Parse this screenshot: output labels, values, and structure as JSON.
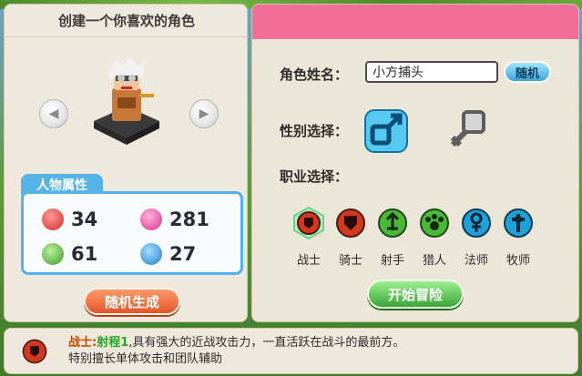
{
  "left_panel": {
    "title": "创建一个你喜欢的角色",
    "attributes_title": "人物属性",
    "attributes": [
      {
        "value": "34",
        "icon": "attack-icon",
        "color": "#e24a4a"
      },
      {
        "value": "281",
        "icon": "heart-icon",
        "color": "#e64aa5"
      },
      {
        "value": "61",
        "icon": "agility-icon",
        "color": "#58c23b"
      },
      {
        "value": "27",
        "icon": "defense-icon",
        "color": "#3aa0e8"
      }
    ],
    "random_generate_label": "随机生成"
  },
  "right_panel": {
    "name_label": "角色姓名：",
    "name_value": "小方捕头",
    "random_label": "随机",
    "gender_label": "性别选择：",
    "job_label": "职业选择：",
    "jobs": [
      {
        "label": "战士",
        "icon": "warrior-icon",
        "color": "#d2371f"
      },
      {
        "label": "骑士",
        "icon": "knight-icon",
        "color": "#d2371f"
      },
      {
        "label": "射手",
        "icon": "archer-icon",
        "color": "#4bb83a"
      },
      {
        "label": "猎人",
        "icon": "hunter-icon",
        "color": "#4bb83a"
      },
      {
        "label": "法师",
        "icon": "mage-icon",
        "color": "#1fa0d6"
      },
      {
        "label": "牧师",
        "icon": "priest-icon",
        "color": "#1fa0d6"
      }
    ],
    "start_label": "开始冒险"
  },
  "description": {
    "class_name": "战士:",
    "range_text": "射程1",
    "rest_line1": ",具有强大的近战攻击力，一直活跃在战斗的最前方。",
    "line2": "特别擅长单体攻击和团队辅助"
  }
}
